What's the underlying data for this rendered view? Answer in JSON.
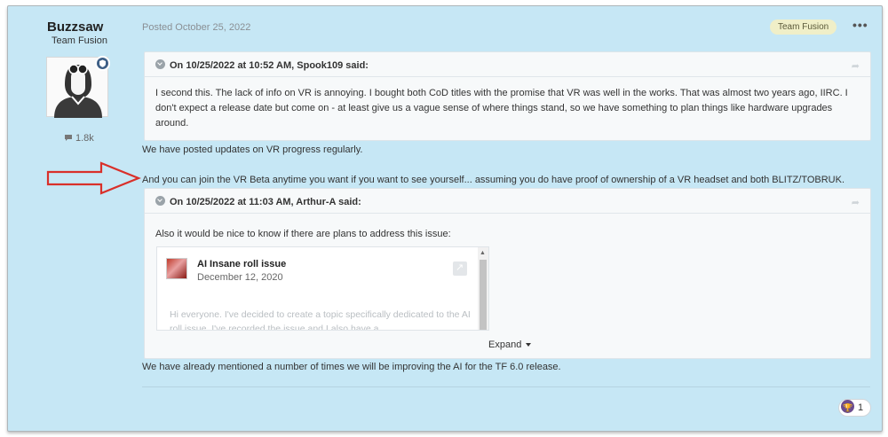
{
  "author": {
    "name": "Buzzsaw",
    "group": "Team Fusion",
    "post_count": "1.8k"
  },
  "post": {
    "posted": "Posted October 25, 2022",
    "tag": "Team Fusion",
    "menu": "•••",
    "reply1": "We have posted updates on VR progress regularly.",
    "reply2": "And you can join the VR Beta anytime you want if you want to see yourself... assuming you do have proof of ownership of a VR headset and both BLITZ/TOBRUK.",
    "reply3": "We have already mentioned a number of times we will be improving the AI for the TF 6.0 release."
  },
  "quote1": {
    "header": "On 10/25/2022 at 10:52 AM, Spook109 said:",
    "body": "I second this. The lack of info on VR is annoying. I bought both CoD titles with the promise that VR was well in the works. That was almost two years ago, IIRC. I don't expect a release date but come on - at least give us a vague sense of where things stand, so we have something to plan things like hardware upgrades around."
  },
  "quote2": {
    "header": "On 10/25/2022 at 11:03 AM, Arthur-A said:",
    "body": "Also it would be nice to know if there are plans to address this issue:",
    "embed": {
      "title": "AI Insane roll issue",
      "date": "December 12, 2020",
      "excerpt": "Hi everyone. I've decided to create a topic specifically dedicated to the AI roll issue. I've recorded the issue and I also have a"
    },
    "expand_label": "Expand"
  },
  "reactions": {
    "count": "1"
  },
  "colors": {
    "background": "#c6e7f5",
    "arrow": "#d9302a",
    "tag_bg": "#f0efc8",
    "badge": "#3e5f86",
    "trophy": "#6b4c8e"
  }
}
